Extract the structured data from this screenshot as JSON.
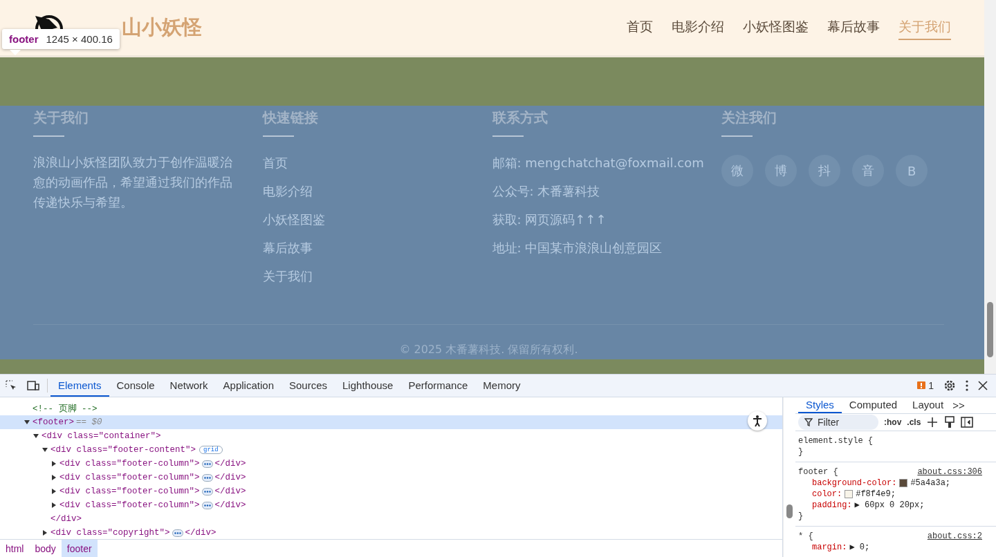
{
  "site": {
    "brand": "山小妖怪",
    "nav": [
      {
        "label": "首页",
        "selected": false
      },
      {
        "label": "电影介绍",
        "selected": false
      },
      {
        "label": "小妖怪图鉴",
        "selected": false
      },
      {
        "label": "幕后故事",
        "selected": false
      },
      {
        "label": "关于我们",
        "selected": true
      }
    ]
  },
  "inspect_tooltip": {
    "tag": "footer",
    "size": "1245 × 400.16"
  },
  "footer": {
    "columns": [
      {
        "kind": "text",
        "title": "关于我们",
        "text": "浪浪山小妖怪团队致力于创作温暖治愈的动画作品，希望通过我们的作品传递快乐与希望。"
      },
      {
        "kind": "links",
        "title": "快速链接",
        "items": [
          "首页",
          "电影介绍",
          "小妖怪图鉴",
          "幕后故事",
          "关于我们"
        ]
      },
      {
        "kind": "contacts",
        "title": "联系方式",
        "items": [
          "邮箱: mengchatchat@foxmail.com",
          "公众号: 木番薯科技",
          "获取: 网页源码↑↑↑",
          "地址: 中国某市浪浪山创意园区"
        ]
      },
      {
        "kind": "social",
        "title": "关注我们",
        "items": [
          "微",
          "博",
          "抖",
          "音",
          "B"
        ]
      }
    ],
    "copyright": "© 2025 木番薯科技. 保留所有权利."
  },
  "devtools": {
    "tabs": [
      {
        "label": "Elements",
        "selected": true
      },
      {
        "label": "Console",
        "selected": false
      },
      {
        "label": "Network",
        "selected": false
      },
      {
        "label": "Application",
        "selected": false
      },
      {
        "label": "Sources",
        "selected": false
      },
      {
        "label": "Lighthouse",
        "selected": false
      },
      {
        "label": "Performance",
        "selected": false
      },
      {
        "label": "Memory",
        "selected": false
      }
    ],
    "issues_count": "1",
    "tree": [
      {
        "kind": "comment",
        "text": "<!-- 页脚 -->"
      },
      {
        "kind": "element",
        "text": "<footer>",
        "suffix": "== $0",
        "selected": true,
        "expanded": true,
        "children": [
          {
            "kind": "element",
            "text": "<div class=\"container\">",
            "selected": false,
            "expanded": true,
            "children": [
              {
                "kind": "element",
                "text": "<div class=\"footer-content\">",
                "badge": "grid",
                "selected": false,
                "expanded": true,
                "children": [
                  {
                    "kind": "element",
                    "text": "<div class=\"footer-column\">",
                    "tail": "</div>",
                    "selected": false,
                    "expanded": false
                  },
                  {
                    "kind": "element",
                    "text": "<div class=\"footer-column\">",
                    "tail": "</div>",
                    "selected": false,
                    "expanded": false
                  },
                  {
                    "kind": "element",
                    "text": "<div class=\"footer-column\">",
                    "tail": "</div>",
                    "selected": false,
                    "expanded": false
                  },
                  {
                    "kind": "element",
                    "text": "<div class=\"footer-column\">",
                    "tail": "</div>",
                    "selected": false,
                    "expanded": false
                  }
                ]
              },
              {
                "kind": "close",
                "text": "</div>"
              },
              {
                "kind": "element",
                "text": "<div class=\"copyright\">",
                "tail": "</div>",
                "selected": false,
                "expanded": false
              }
            ]
          }
        ]
      }
    ],
    "breadcrumbs": [
      {
        "label": "html",
        "selected": false
      },
      {
        "label": "body",
        "selected": false
      },
      {
        "label": "footer",
        "selected": true
      }
    ],
    "side_tabs": [
      {
        "label": "Styles",
        "selected": true
      },
      {
        "label": "Computed",
        "selected": false
      },
      {
        "label": "Layout",
        "selected": false
      }
    ],
    "side_more": ">>",
    "filter": {
      "placeholder": "Filter"
    },
    "toggles": [
      ":hov",
      ".cls"
    ],
    "rules": [
      {
        "selector": "element.style {",
        "close": "}"
      },
      {
        "selector": "footer {",
        "source": "about.css:306",
        "close": "}",
        "properties": [
          {
            "name": "background-color:",
            "value": "#5a4a3a;",
            "color": "#5a4a3a"
          },
          {
            "name": "color:",
            "value": "#f8f4e9;",
            "color": "#f8f4e9"
          },
          {
            "name": "padding:",
            "value": "▶ 60px 0 20px;"
          }
        ]
      },
      {
        "selector": "* {",
        "source": "about.css:2",
        "properties": [
          {
            "name": "margin:",
            "value": "▶ 0;"
          }
        ]
      }
    ]
  }
}
